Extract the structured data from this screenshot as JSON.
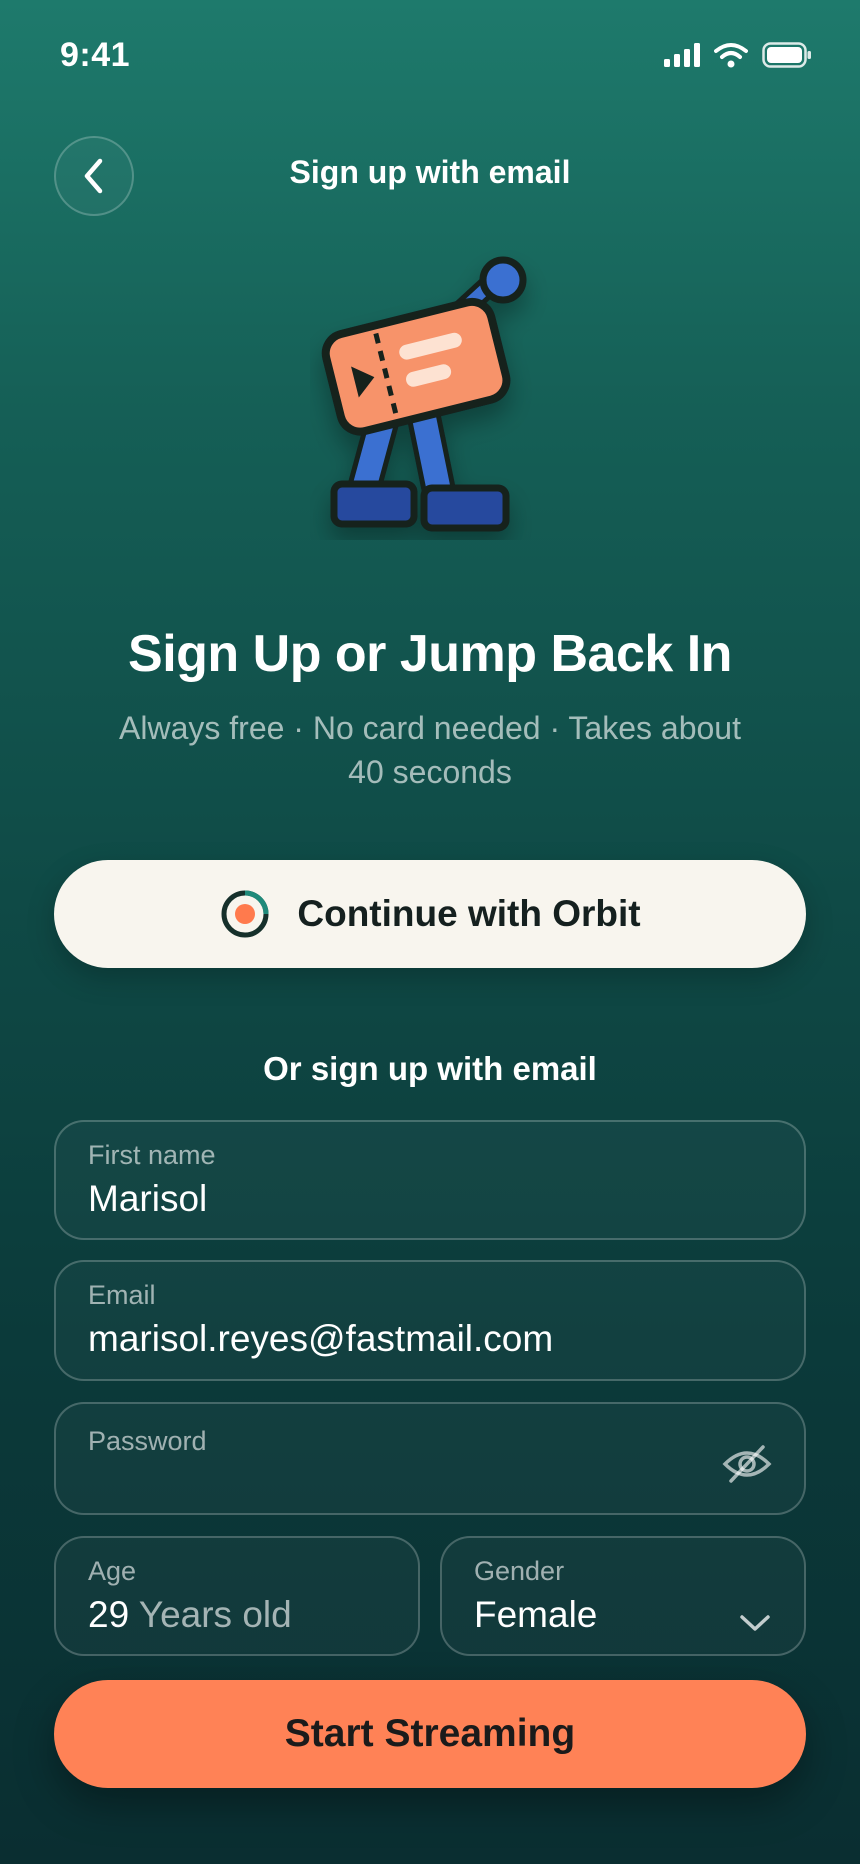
{
  "status_bar": {
    "time": "9:41",
    "icons": [
      "cellular-signal-icon",
      "wifi-icon",
      "battery-icon"
    ]
  },
  "header": {
    "title": "Sign up with email",
    "back_icon": "chevron-left-icon"
  },
  "hero": {
    "title": "Sign Up or Jump Back In",
    "subtitle": "Always free · No card needed · Takes about 40 seconds"
  },
  "orbit_button": {
    "label": "Continue with Orbit",
    "icon": "orbit-logo-icon"
  },
  "divider_text": "Or sign up with email",
  "form": {
    "first_name": {
      "label": "First name",
      "value": "Marisol"
    },
    "email": {
      "label": "Email",
      "value": "marisol.reyes@fastmail.com"
    },
    "password": {
      "label": "Password",
      "value": "",
      "toggle_icon": "eye-off-icon"
    },
    "age": {
      "label": "Age",
      "value": "29",
      "unit": "Years old"
    },
    "gender": {
      "label": "Gender",
      "value": "Female",
      "icon": "chevron-down-icon"
    }
  },
  "cta": {
    "label": "Start Streaming"
  },
  "colors": {
    "background_top": "#1e7a6c",
    "background_bottom": "#0a2e31",
    "accent": "#ff8256",
    "orbit_button_bg": "#f8f5ee",
    "mascot_ticket": "#f7936b",
    "mascot_legs": "#3a6fd1"
  }
}
